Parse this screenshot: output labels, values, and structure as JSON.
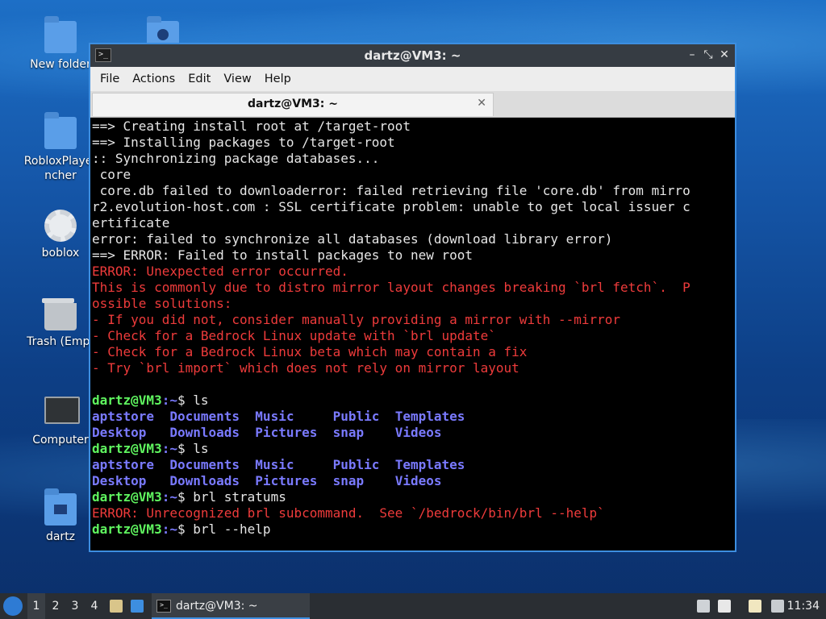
{
  "desktop": {
    "icons": [
      {
        "label": "New folder"
      },
      {
        "label": ""
      },
      {
        "label": "RobloxPlayer\nncher"
      },
      {
        "label": "boblox"
      },
      {
        "label": "Trash (Empt"
      },
      {
        "label": "Computer"
      },
      {
        "label": "dartz"
      }
    ]
  },
  "window": {
    "title": "dartz@VM3: ~",
    "menu": [
      "File",
      "Actions",
      "Edit",
      "View",
      "Help"
    ],
    "tab_label": "dartz@VM3: ~",
    "lines": [
      {
        "t": "==> Creating install root at /target-root",
        "c": ""
      },
      {
        "t": "==> Installing packages to /target-root",
        "c": ""
      },
      {
        "t": ":: Synchronizing package databases...",
        "c": ""
      },
      {
        "t": " core",
        "c": ""
      },
      {
        "t": " core.db failed to downloaderror: failed retrieving file 'core.db' from mirro",
        "c": ""
      },
      {
        "t": "r2.evolution-host.com : SSL certificate problem: unable to get local issuer c",
        "c": ""
      },
      {
        "t": "ertificate",
        "c": ""
      },
      {
        "t": "error: failed to synchronize all databases (download library error)",
        "c": ""
      },
      {
        "t": "==> ERROR: Failed to install packages to new root",
        "c": ""
      },
      {
        "t": "ERROR: Unexpected error occurred.",
        "c": "red"
      },
      {
        "t": "This is commonly due to distro mirror layout changes breaking `brl fetch`.  P",
        "c": "red"
      },
      {
        "t": "ossible solutions:",
        "c": "red"
      },
      {
        "t": "- If you did not, consider manually providing a mirror with --mirror",
        "c": "red"
      },
      {
        "t": "- Check for a Bedrock Linux update with `brl update`",
        "c": "red"
      },
      {
        "t": "- Check for a Bedrock Linux beta which may contain a fix",
        "c": "red"
      },
      {
        "t": "- Try `brl import` which does not rely on mirror layout",
        "c": "red"
      },
      {
        "t": "",
        "c": ""
      }
    ],
    "prompt_user": "dartz@VM3",
    "prompt_path": ":~",
    "commands": [
      {
        "cmd": "$ ls",
        "output": [
          [
            "aptstore  ",
            "Documents  ",
            "Music     ",
            "Public  ",
            "Templates"
          ],
          [
            "Desktop   ",
            "Downloads  ",
            "Pictures  ",
            "snap    ",
            "Videos"
          ]
        ]
      },
      {
        "cmd": "$ ls",
        "output": [
          [
            "aptstore  ",
            "Documents  ",
            "Music     ",
            "Public  ",
            "Templates"
          ],
          [
            "Desktop   ",
            "Downloads  ",
            "Pictures  ",
            "snap    ",
            "Videos"
          ]
        ]
      },
      {
        "cmd": "$ brl stratums",
        "error": "ERROR: Unrecognized brl subcommand.  See `/bedrock/bin/brl --help`"
      },
      {
        "cmd": "$ brl --help"
      }
    ]
  },
  "taskbar": {
    "workspaces": [
      "1",
      "2",
      "3",
      "4"
    ],
    "task_label": "dartz@VM3: ~",
    "clock": "11:34"
  }
}
